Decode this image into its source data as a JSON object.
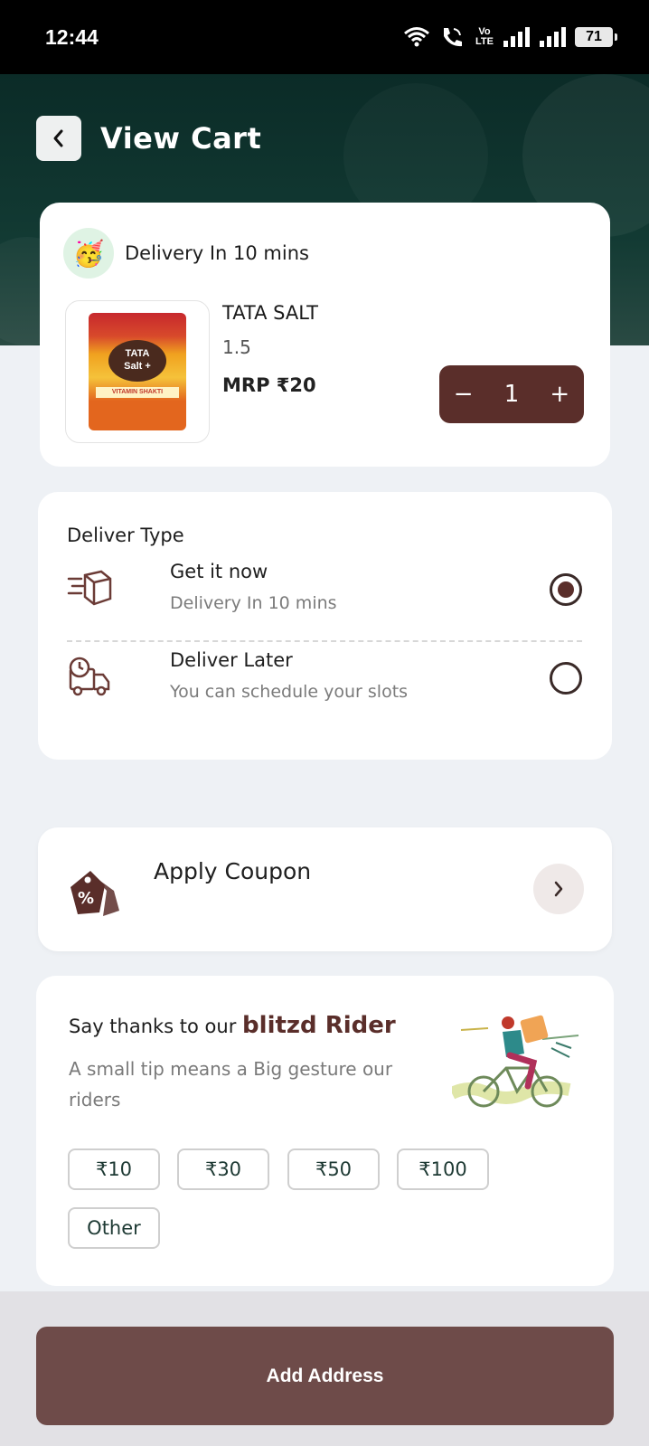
{
  "status_bar": {
    "time": "12:44",
    "network_label_top": "Vo",
    "network_label_bottom": "LTE",
    "battery": "71",
    "icons": [
      "wifi-icon",
      "call-icon",
      "signal-icon",
      "signal-icon",
      "battery-icon"
    ]
  },
  "header": {
    "title": "View Cart"
  },
  "cart": {
    "delivery_text": "Delivery In 10 mins",
    "delivery_emoji": "🥳",
    "product": {
      "name": "TATA SALT",
      "quantity_label": "1.5",
      "price": "MRP ₹20",
      "count": "1",
      "pack_brand": "TATA",
      "pack_sub": "Salt +",
      "pack_band": "VITAMIN SHAKTI"
    },
    "stepper": {
      "minus": "−",
      "plus": "+"
    }
  },
  "delivery_type": {
    "title": "Deliver Type",
    "options": [
      {
        "label": "Get it now",
        "sub": "Delivery In 10 mins",
        "selected": true
      },
      {
        "label": "Deliver Later",
        "sub": "You can schedule your slots",
        "selected": false
      }
    ]
  },
  "coupon": {
    "label": "Apply Coupon"
  },
  "tip": {
    "title_prefix": "Say thanks to our",
    "brand": "blitzd Rider",
    "description": "A small tip means a Big gesture our riders",
    "chips": [
      "₹10",
      "₹30",
      "₹50",
      "₹100",
      "Other"
    ]
  },
  "footer": {
    "cta_label": "Add Address"
  },
  "colors": {
    "accent": "#5a2e2a",
    "cta": "#6e4b49",
    "header_bg": "#0b2b27"
  }
}
